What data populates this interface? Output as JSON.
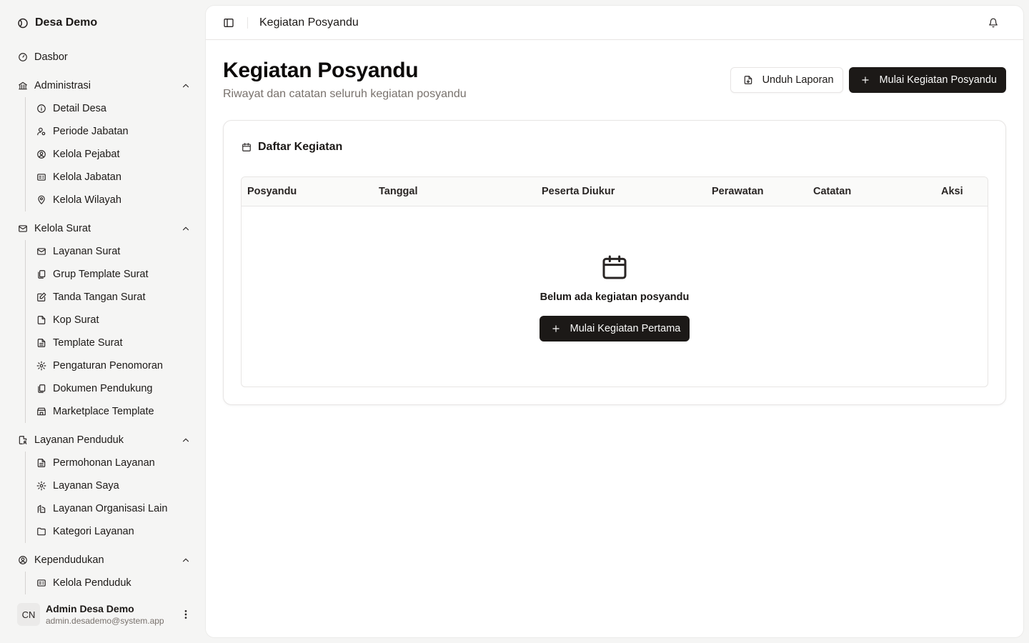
{
  "brand": {
    "name": "Desa Demo"
  },
  "nav": {
    "dashboard": "Dasbor",
    "groups": [
      {
        "label": "Administrasi",
        "items": [
          "Detail Desa",
          "Periode Jabatan",
          "Kelola Pejabat",
          "Kelola Jabatan",
          "Kelola Wilayah"
        ]
      },
      {
        "label": "Kelola Surat",
        "items": [
          "Layanan Surat",
          "Grup Template Surat",
          "Tanda Tangan Surat",
          "Kop Surat",
          "Template Surat",
          "Pengaturan Penomoran",
          "Dokumen Pendukung",
          "Marketplace Template"
        ]
      },
      {
        "label": "Layanan Penduduk",
        "items": [
          "Permohonan Layanan",
          "Layanan Saya",
          "Layanan Organisasi Lain",
          "Kategori Layanan"
        ]
      },
      {
        "label": "Kependudukan",
        "items": [
          "Kelola Penduduk"
        ]
      }
    ]
  },
  "user": {
    "initials": "CN",
    "name": "Admin Desa Demo",
    "email": "admin.desademo@system.app"
  },
  "topbar": {
    "breadcrumb": "Kegiatan Posyandu"
  },
  "page": {
    "title": "Kegiatan Posyandu",
    "subtitle": "Riwayat dan catatan seluruh kegiatan posyandu",
    "download_label": "Unduh Laporan",
    "start_label": "Mulai Kegiatan Posyandu"
  },
  "card": {
    "title": "Daftar Kegiatan",
    "columns": [
      "Posyandu",
      "Tanggal",
      "Peserta Diukur",
      "Perawatan",
      "Catatan",
      "Aksi"
    ],
    "empty_text": "Belum ada kegiatan posyandu",
    "empty_button": "Mulai Kegiatan Pertama"
  }
}
